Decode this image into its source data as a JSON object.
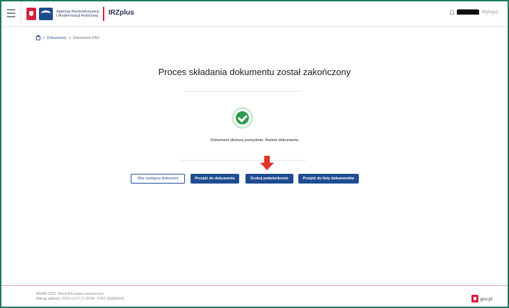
{
  "header": {
    "agency_line1": "Agencja Restrukturyzacji",
    "agency_line2": "i Modernizacji Rolnictwa",
    "app_name": "IRZplus",
    "user_name": "████████",
    "logout_label": "Wyloguj"
  },
  "breadcrumb": {
    "separator1": ">",
    "item1": "Dokumenty",
    "separator2": ">",
    "current": "Dokument ZKD"
  },
  "main": {
    "title": "Proces składania dokumentu został zakończony",
    "status_message": "Dokument złożony pomyślnie. Numer dokumentu",
    "buttons": {
      "next_document": "Złóż następny dokument",
      "go_to_document": "Przejdź do dokumentu",
      "print_confirmation": "Drukuj potwierdzenie",
      "go_to_list": "Przejdź do listy dokumentów"
    }
  },
  "footer": {
    "copyright": "ARiMR 2022. Wszystkie prawa zastrzeżone",
    "version": "Wersja aplikacji: 2022-12-07 17:25:58 - P051 (5bd0b5cd)",
    "gov_label": "gov.pl"
  },
  "colors": {
    "frame_border": "#1c7a5f",
    "primary": "#1f4b8f",
    "success": "#2f9a52",
    "arrow": "#e03527",
    "brand_red": "#d4213d"
  },
  "icons": [
    "hamburger-icon",
    "eagle-icon",
    "arimr-logo-icon",
    "user-icon",
    "home-icon",
    "check-circle-icon",
    "red-arrow-down-icon",
    "gov-eagle-icon"
  ]
}
